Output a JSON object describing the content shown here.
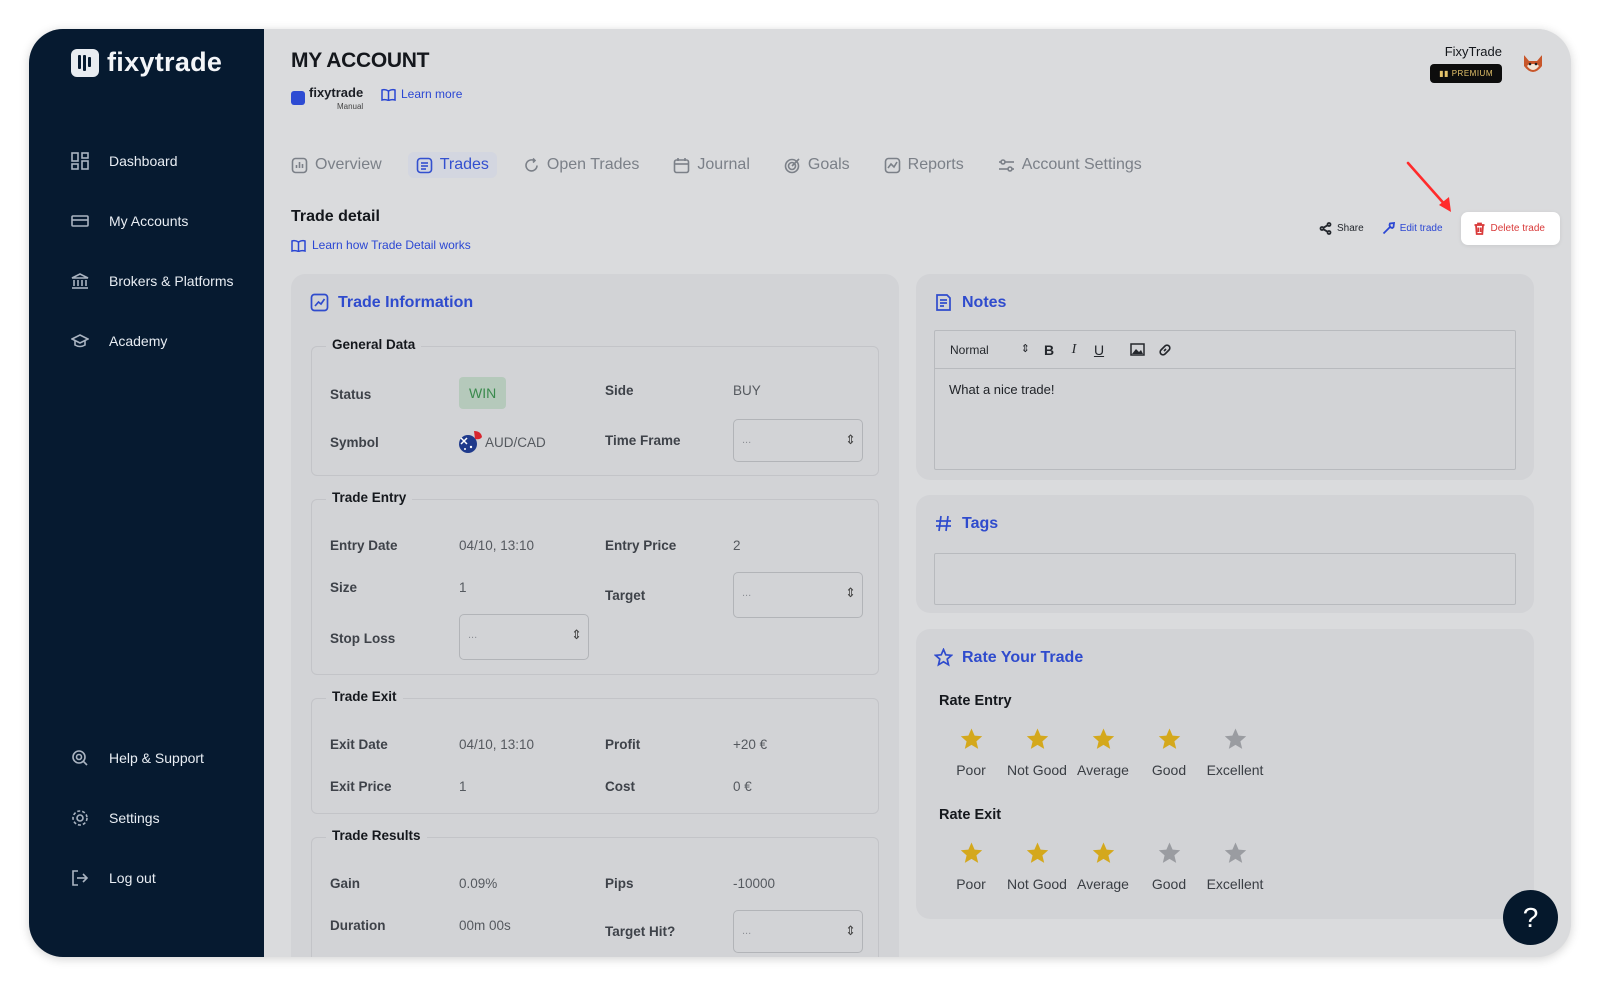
{
  "brand": {
    "name": "fixytrade"
  },
  "sidebar": {
    "items": [
      {
        "label": "Dashboard",
        "icon": "dashboard-icon"
      },
      {
        "label": "My Accounts",
        "icon": "accounts-icon"
      },
      {
        "label": "Brokers & Platforms",
        "icon": "bank-icon"
      },
      {
        "label": "Academy",
        "icon": "graduation-cap-icon"
      }
    ],
    "bottom_items": [
      {
        "label": "Help & Support",
        "icon": "help-icon"
      },
      {
        "label": "Settings",
        "icon": "gear-icon"
      },
      {
        "label": "Log out",
        "icon": "logout-icon"
      }
    ]
  },
  "header": {
    "title": "MY ACCOUNT",
    "account_brand": "fixytrade",
    "account_type": "Manual",
    "learn_more": "Learn more",
    "user_name": "FixyTrade",
    "premium_badge": "PREMIUM"
  },
  "tabs": [
    {
      "label": "Overview",
      "icon": "chart-icon",
      "active": false
    },
    {
      "label": "Trades",
      "icon": "list-icon",
      "active": true
    },
    {
      "label": "Open Trades",
      "icon": "refresh-icon",
      "active": false
    },
    {
      "label": "Journal",
      "icon": "calendar-icon",
      "active": false
    },
    {
      "label": "Goals",
      "icon": "target-icon",
      "active": false
    },
    {
      "label": "Reports",
      "icon": "report-icon",
      "active": false
    },
    {
      "label": "Account Settings",
      "icon": "sliders-icon",
      "active": false
    }
  ],
  "trade_detail": {
    "title": "Trade detail",
    "learn_link": "Learn how Trade Detail works",
    "actions": {
      "share": "Share",
      "edit": "Edit trade",
      "delete": "Delete trade"
    }
  },
  "trade_info": {
    "title": "Trade Information",
    "general": {
      "label": "General Data",
      "status_label": "Status",
      "status_value": "WIN",
      "side_label": "Side",
      "side_value": "BUY",
      "symbol_label": "Symbol",
      "symbol_value": "AUD/CAD",
      "timeframe_label": "Time Frame",
      "timeframe_value": "..."
    },
    "entry": {
      "label": "Trade Entry",
      "date_label": "Entry Date",
      "date_value": "04/10, 13:10",
      "price_label": "Entry Price",
      "price_value": "2",
      "size_label": "Size",
      "size_value": "1",
      "target_label": "Target",
      "target_value": "...",
      "stop_label": "Stop Loss",
      "stop_value": "..."
    },
    "exit": {
      "label": "Trade Exit",
      "date_label": "Exit Date",
      "date_value": "04/10, 13:10",
      "profit_label": "Profit",
      "profit_value": "+20 €",
      "price_label": "Exit Price",
      "price_value": "1",
      "cost_label": "Cost",
      "cost_value": "0 €"
    },
    "results": {
      "label": "Trade Results",
      "gain_label": "Gain",
      "gain_value": "0.09%",
      "pips_label": "Pips",
      "pips_value": "-10000",
      "duration_label": "Duration",
      "duration_value": "00m 00s",
      "targethit_label": "Target Hit?",
      "targethit_value": "..."
    }
  },
  "notes": {
    "title": "Notes",
    "format": "Normal",
    "bold": "B",
    "italic": "I",
    "underline": "U",
    "content": "What a nice trade!"
  },
  "tags": {
    "title": "Tags"
  },
  "rating": {
    "title": "Rate Your Trade",
    "entry_label": "Rate Entry",
    "exit_label": "Rate Exit",
    "levels": [
      "Poor",
      "Not Good",
      "Average",
      "Good",
      "Excellent"
    ],
    "entry_stars": 4,
    "exit_stars": 3,
    "colors": {
      "filled": "#d4a81c",
      "empty": "#9a9ca1"
    }
  },
  "help_button": "?"
}
